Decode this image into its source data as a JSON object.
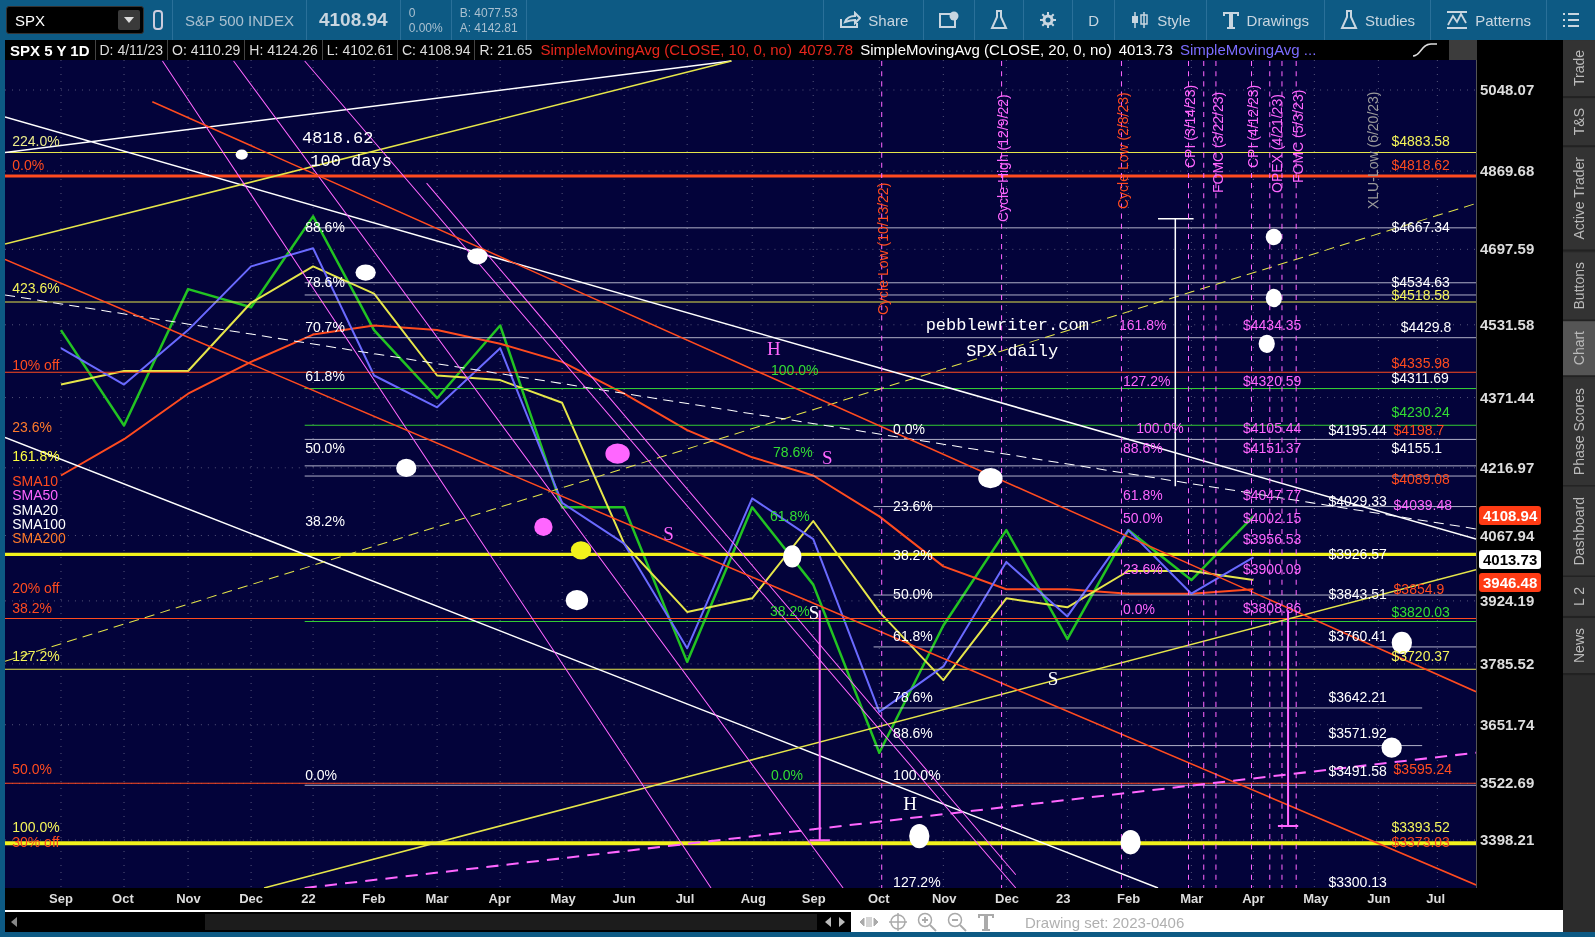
{
  "symbol": {
    "value": "SPX"
  },
  "quote": {
    "name": "S&P 500 INDEX",
    "last": "4108.94",
    "change": "0",
    "change_pct": "0.00%",
    "bid": "B: 4077.53",
    "ask": "A: 4142.81"
  },
  "toolbar": [
    {
      "label": "Share"
    },
    {
      "label": "D"
    },
    {
      "label": "Style"
    },
    {
      "label": "Drawings"
    },
    {
      "label": "Studies"
    },
    {
      "label": "Patterns"
    }
  ],
  "info_bar": {
    "title": "SPX 5 Y 1D",
    "fields": [
      "D: 4/11/23",
      "O: 4110.29",
      "H: 4124.26",
      "L: 4102.61",
      "C: 4108.94",
      "R: 21.65"
    ],
    "studies": [
      {
        "label": "SimpleMovingAvg (CLOSE, 10, 0, no)",
        "value": "4079.78",
        "color": "#e8261c"
      },
      {
        "label": "SimpleMovingAvg (CLOSE, 20, 0, no)",
        "value": "4013.73",
        "color": "#ffffff"
      },
      {
        "label": "SimpleMovingAvg ...",
        "color": "#7b6cff"
      }
    ]
  },
  "chart": {
    "chart_data": {
      "type": "line",
      "categories": [
        "Sep",
        "Oct",
        "Nov",
        "Dec",
        "22",
        "Feb",
        "Mar",
        "Apr",
        "May",
        "Jun",
        "Jul",
        "Aug",
        "Sep",
        "Oct",
        "Nov",
        "Dec",
        "23",
        "Feb",
        "Mar",
        "Apr",
        "May",
        "Jun",
        "Jul"
      ],
      "series": [
        {
          "color": "#22c322",
          "values": [
            4520,
            4310,
            4610,
            4570,
            4770,
            4520,
            4370,
            4530,
            4130,
            4130,
            3790,
            4130,
            3960,
            3590,
            3870,
            4080,
            3840,
            4080,
            3970,
            4110,
            null,
            null,
            null
          ]
        },
        {
          "color": "#ff4b1f",
          "values": [
            4200,
            4280,
            4380,
            4450,
            4510,
            4530,
            4520,
            4490,
            4450,
            4380,
            4300,
            4240,
            4200,
            4110,
            4000,
            3950,
            3950,
            3940,
            3940,
            3950,
            null,
            null,
            null
          ]
        },
        {
          "color": "#e6e64a",
          "values": [
            4400,
            4430,
            4430,
            4580,
            4660,
            4600,
            4420,
            4410,
            4360,
            4050,
            3900,
            3930,
            4100,
            3900,
            3750,
            3930,
            3910,
            3990,
            3990,
            3970,
            null,
            null,
            null
          ]
        },
        {
          "color": "#6a6aff",
          "values": [
            4480,
            4400,
            4520,
            4660,
            4700,
            4420,
            4350,
            4480,
            4140,
            4050,
            3820,
            4150,
            4060,
            3680,
            3780,
            4010,
            3890,
            4080,
            3940,
            4020,
            null,
            null,
            null
          ]
        }
      ],
      "ylim": [
        3292.6,
        5114.1
      ],
      "grid": true,
      "yticks": [
        {
          "value": 5048.07,
          "label": "5048.07"
        },
        {
          "value": 4869.68,
          "label": "4869.68"
        },
        {
          "value": 4697.59,
          "label": "4697.59"
        },
        {
          "value": 4531.58,
          "label": "4531.58"
        },
        {
          "value": 4371.44,
          "label": "4371.44"
        },
        {
          "value": 4216.97,
          "label": "4216.97"
        },
        {
          "value": 4067.94,
          "label": "4067.94"
        },
        {
          "value": 3924.19,
          "label": "3924.19"
        },
        {
          "value": 3785.52,
          "label": "3785.52"
        },
        {
          "value": 3651.74,
          "label": "3651.74"
        },
        {
          "value": 3522.69,
          "label": "3522.69"
        },
        {
          "value": 3398.21,
          "label": "3398.21"
        }
      ]
    }
  },
  "annotations": [
    {
      "text": "224.0%",
      "color": "#ecec8a",
      "kind": "label"
    },
    {
      "text": "0.0%",
      "color": "#ff4b1f",
      "kind": "label"
    },
    {
      "text": "423.6%",
      "color": "#f4f45a",
      "kind": "label"
    },
    {
      "text": "10% off",
      "color": "#ff4b1f",
      "kind": "label"
    },
    {
      "text": "23.6%",
      "color": "#ff7a2a",
      "kind": "label"
    },
    {
      "text": "161.8%",
      "color": "#ffff40",
      "kind": "label"
    },
    {
      "text": "SMA10",
      "color": "#ff4b1f",
      "kind": "label"
    },
    {
      "text": "SMA50",
      "color": "#ff66ff",
      "kind": "label"
    },
    {
      "text": "SMA20",
      "color": "#ffffff",
      "kind": "label"
    },
    {
      "text": "SMA100",
      "color": "#ffffff",
      "kind": "label"
    },
    {
      "text": "SMA200",
      "color": "#ff7a2a",
      "kind": "label"
    },
    {
      "text": "20% off",
      "color": "#ff4b1f",
      "kind": "label"
    },
    {
      "text": "38.2%",
      "color": "#ff4b1f",
      "kind": "label"
    },
    {
      "text": "127.2%",
      "color": "#f4f45a",
      "kind": "label"
    },
    {
      "text": "50.0%",
      "color": "#ff4b1f",
      "kind": "label"
    },
    {
      "text": "100.0%",
      "color": "#f4f45a",
      "kind": "label"
    },
    {
      "text": "30% off",
      "color": "#ff4b1f",
      "kind": "label"
    },
    {
      "text": "4818.62",
      "color": "#ffffff",
      "kind": "big"
    },
    {
      "text": "100 days",
      "color": "#ffffff",
      "kind": "big"
    },
    {
      "text": "88.6%",
      "color": "#ffffff",
      "kind": "label"
    },
    {
      "text": "78.6%",
      "color": "#ffffff",
      "kind": "label"
    },
    {
      "text": "70.7%",
      "color": "#ffffff",
      "kind": "label"
    },
    {
      "text": "61.8%",
      "color": "#ffffff",
      "kind": "label"
    },
    {
      "text": "50.0%",
      "color": "#ffffff",
      "kind": "label"
    },
    {
      "text": "38.2%",
      "color": "#ffffff",
      "kind": "label"
    },
    {
      "text": "0.0%",
      "color": "#ffffff",
      "kind": "label"
    },
    {
      "text": "H",
      "color": "#ff66ff",
      "kind": "letter"
    },
    {
      "text": "100.0%",
      "color": "#33dd33",
      "kind": "label"
    },
    {
      "text": "78.6%",
      "color": "#33dd33",
      "kind": "label"
    },
    {
      "text": "S",
      "color": "#ff66ff",
      "kind": "letter"
    },
    {
      "text": "S",
      "color": "#ff66ff",
      "kind": "letter"
    },
    {
      "text": "61.8%",
      "color": "#33dd33",
      "kind": "label"
    },
    {
      "text": "38.2%",
      "color": "#33dd33",
      "kind": "label"
    },
    {
      "text": "S",
      "color": "#ffffff",
      "kind": "letter"
    },
    {
      "text": "0.0%",
      "color": "#33dd33",
      "kind": "label"
    },
    {
      "text": "pebblewriter.com",
      "color": "#ffffff",
      "kind": "big"
    },
    {
      "text": "SPX daily",
      "color": "#ffffff",
      "kind": "big"
    },
    {
      "text": "0.0%",
      "color": "#ffffff",
      "kind": "label"
    },
    {
      "text": "23.6%",
      "color": "#ffffff",
      "kind": "label"
    },
    {
      "text": "38.2%",
      "color": "#ffffff",
      "kind": "label"
    },
    {
      "text": "50.0%",
      "color": "#ffffff",
      "kind": "label"
    },
    {
      "text": "61.8%",
      "color": "#ffffff",
      "kind": "label"
    },
    {
      "text": "78.6%",
      "color": "#ffffff",
      "kind": "label"
    },
    {
      "text": "88.6%",
      "color": "#ffffff",
      "kind": "label"
    },
    {
      "text": "100.0%",
      "color": "#ffffff",
      "kind": "label"
    },
    {
      "text": "H",
      "color": "#ffffff",
      "kind": "letter"
    },
    {
      "text": "S",
      "color": "#ffffff",
      "kind": "letter"
    },
    {
      "text": "127.2%",
      "color": "#ffffff",
      "kind": "label"
    },
    {
      "text": "161.8%",
      "color": "#ff66ff",
      "kind": "label"
    },
    {
      "text": "127.2%",
      "color": "#ff66ff",
      "kind": "label"
    },
    {
      "text": "100.0%",
      "color": "#ff66ff",
      "kind": "label"
    },
    {
      "text": "88.6%",
      "color": "#ff66ff",
      "kind": "label"
    },
    {
      "text": "61.8%",
      "color": "#ff66ff",
      "kind": "label"
    },
    {
      "text": "50.0%",
      "color": "#ff66ff",
      "kind": "label"
    },
    {
      "text": "23.6%",
      "color": "#ff66ff",
      "kind": "label"
    },
    {
      "text": "0.0%",
      "color": "#ff66ff",
      "kind": "label"
    },
    {
      "text": "$4434.35",
      "color": "#ff66ff",
      "kind": "label"
    },
    {
      "text": "$4320.59",
      "color": "#ff66ff",
      "kind": "label"
    },
    {
      "text": "$4105.44",
      "color": "#ff66ff",
      "kind": "label"
    },
    {
      "text": "$4151.37",
      "color": "#ff66ff",
      "kind": "label"
    },
    {
      "text": "$4047.77",
      "color": "#ff66ff",
      "kind": "label"
    },
    {
      "text": "$4002.15",
      "color": "#ff66ff",
      "kind": "label"
    },
    {
      "text": "$3956.53",
      "color": "#ff66ff",
      "kind": "label"
    },
    {
      "text": "$3900.09",
      "color": "#ff66ff",
      "kind": "label"
    },
    {
      "text": "$3808.86",
      "color": "#ff66ff",
      "kind": "label"
    },
    {
      "text": "$4883.58",
      "color": "#f4f45a",
      "kind": "label"
    },
    {
      "text": "$4818.62",
      "color": "#ff4b1f",
      "kind": "label"
    },
    {
      "text": "$4667.34",
      "color": "#ffffff",
      "kind": "label"
    },
    {
      "text": "$4534.63",
      "color": "#ffffff",
      "kind": "label"
    },
    {
      "text": "$4518.58",
      "color": "#f4f45a",
      "kind": "label"
    },
    {
      "text": "$4429.8",
      "color": "#ffffff",
      "kind": "label"
    },
    {
      "text": "$4335.98",
      "color": "#ff4b1f",
      "kind": "label"
    },
    {
      "text": "$4311.69",
      "color": "#ffffff",
      "kind": "label"
    },
    {
      "text": "$4230.24",
      "color": "#33dd33",
      "kind": "label"
    },
    {
      "text": "$4195.44",
      "color": "#ffffff",
      "kind": "label"
    },
    {
      "text": "$4198.7",
      "color": "#ff4b1f",
      "kind": "label"
    },
    {
      "text": "$4155.1",
      "color": "#ffffff",
      "kind": "label"
    },
    {
      "text": "$4089.08",
      "color": "#ff4b1f",
      "kind": "label"
    },
    {
      "text": "$4029.33",
      "color": "#ffffff",
      "kind": "label"
    },
    {
      "text": "$4039.48",
      "color": "#ff66ff",
      "kind": "label"
    },
    {
      "text": "$3926.57",
      "color": "#ffffff",
      "kind": "label"
    },
    {
      "text": "$3843.51",
      "color": "#ffffff",
      "kind": "label"
    },
    {
      "text": "$3854.9",
      "color": "#ff4b1f",
      "kind": "label"
    },
    {
      "text": "$3820.03",
      "color": "#33dd33",
      "kind": "label"
    },
    {
      "text": "$3760.41",
      "color": "#ffffff",
      "kind": "label"
    },
    {
      "text": "$3720.37",
      "color": "#f4f45a",
      "kind": "label"
    },
    {
      "text": "$3642.21",
      "color": "#ffffff",
      "kind": "label"
    },
    {
      "text": "$3571.92",
      "color": "#ffffff",
      "kind": "label"
    },
    {
      "text": "$3491.58",
      "color": "#ffffff",
      "kind": "label"
    },
    {
      "text": "$3595.24",
      "color": "#ff4b1f",
      "kind": "label"
    },
    {
      "text": "$3393.52",
      "color": "#f4f45a",
      "kind": "label"
    },
    {
      "text": "$3373.03",
      "color": "#ff4b1f",
      "kind": "label"
    },
    {
      "text": "$3300.13",
      "color": "#ffffff",
      "kind": "label"
    },
    {
      "text": "Cycle Low (10/13/22)",
      "color": "#ff4b1f",
      "kind": "vertical"
    },
    {
      "text": "Cycle High (12/9/22)",
      "color": "#ff66ff",
      "kind": "vertical"
    },
    {
      "text": "Cycle Low (2/8/23)",
      "color": "#ff4b1f",
      "kind": "vertical"
    },
    {
      "text": "CPI (3/14/23)",
      "color": "#ff66ff",
      "kind": "vertical"
    },
    {
      "text": "FOMC (3/22/23)",
      "color": "#ff66ff",
      "kind": "vertical"
    },
    {
      "text": "CPI (4/12/23)",
      "color": "#ff66ff",
      "kind": "vertical"
    },
    {
      "text": "OPEX (4/21/23)",
      "color": "#ff66ff",
      "kind": "vertical"
    },
    {
      "text": "FOMC (5/3/23)",
      "color": "#ff66ff",
      "kind": "vertical"
    },
    {
      "text": "XLU-Low (6/20/23)",
      "color": "#9a9a9a",
      "kind": "vertical"
    }
  ],
  "price_axis": {
    "badges": [
      {
        "text": "4108.94",
        "color": "#ff3b14"
      },
      {
        "text": "4013.73",
        "color": "#ffffff"
      },
      {
        "text": "3946.48",
        "color": "#ff3b14"
      }
    ]
  },
  "side_tabs": [
    {
      "label": "Trade",
      "selected": false
    },
    {
      "label": "T&S",
      "selected": false
    },
    {
      "label": "Active Trader",
      "selected": false
    },
    {
      "label": "Buttons",
      "selected": false
    },
    {
      "label": "Chart",
      "selected": true
    },
    {
      "label": "Phase Scores",
      "selected": false
    },
    {
      "label": "Dashboard",
      "selected": false
    },
    {
      "label": "L 2",
      "selected": false
    },
    {
      "label": "News",
      "selected": false
    }
  ],
  "drawing_set": "Drawing set: 2023-0406"
}
